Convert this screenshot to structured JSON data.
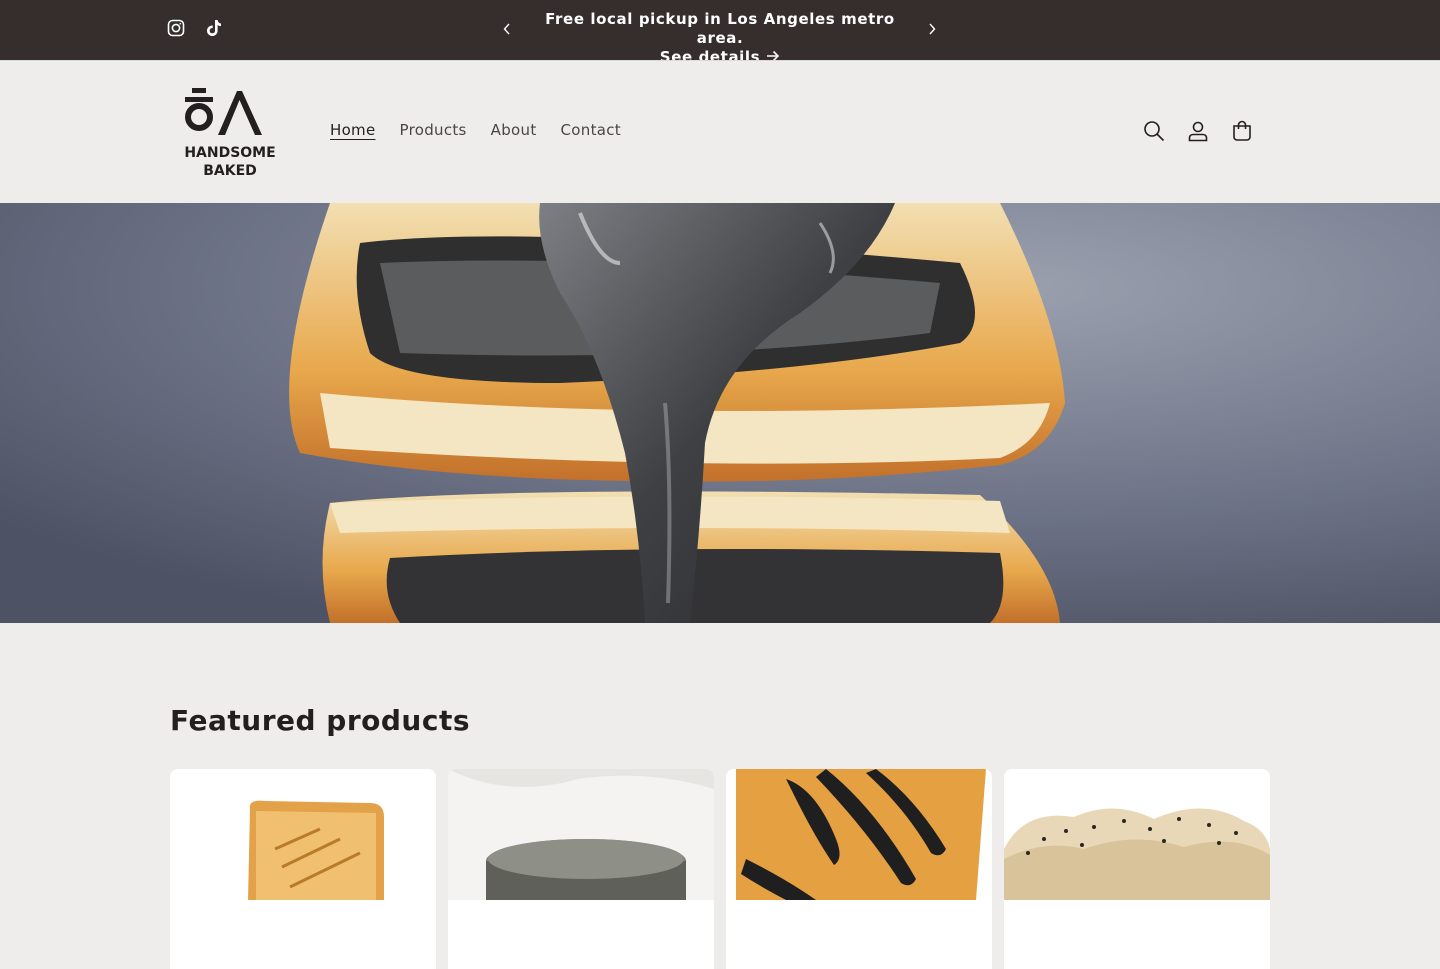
{
  "announcement": {
    "line1": "Free local pickup in Los Angeles metro area.",
    "link_label": "See details",
    "arrow": "→",
    "prev_icon": "chevron-left-icon",
    "next_icon": "chevron-right-icon"
  },
  "social": [
    {
      "icon": "instagram-icon"
    },
    {
      "icon": "tiktok-icon"
    }
  ],
  "logo": {
    "line1": "HANDSOME",
    "line2": "BAKED"
  },
  "nav": {
    "items": [
      {
        "label": "Home",
        "active": true
      },
      {
        "label": "Products",
        "active": false
      },
      {
        "label": "About",
        "active": false
      },
      {
        "label": "Contact",
        "active": false
      }
    ]
  },
  "header_icons": [
    "search-icon",
    "account-icon",
    "cart-icon"
  ],
  "featured": {
    "title": "Featured products"
  },
  "colors": {
    "announce_bg": "#352e2d",
    "page_bg": "#efedeb",
    "text": "#231f20"
  }
}
